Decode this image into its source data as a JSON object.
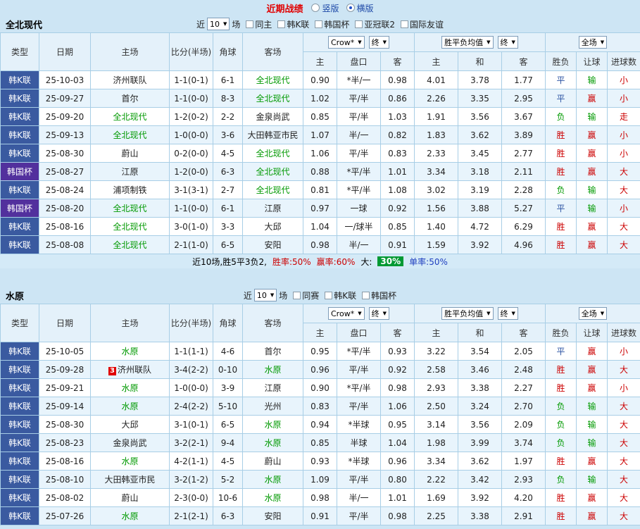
{
  "colors": {
    "accent_red": "#cc0000",
    "lose_green": "#009900",
    "draw_blue": "#2a52a2",
    "focus_team_green": "#009900",
    "league_type_bg": "#3a5aa0",
    "cup_type_bg": "#52309d",
    "highlight_green_bg": "#009933",
    "page_bg": "#cde5f4"
  },
  "top_bar": {
    "title": "近期战绩",
    "radios": [
      {
        "label": "竖版",
        "selected": false
      },
      {
        "label": "横版",
        "selected": true
      }
    ]
  },
  "table_header": {
    "static_cols": [
      "类型",
      "日期",
      "主场",
      "比分(半场)",
      "角球",
      "客场"
    ],
    "odds_group": {
      "dropdowns": [
        "Crow*",
        "终"
      ],
      "cols": [
        "主",
        "盘口",
        "客"
      ]
    },
    "avg_group": {
      "dropdowns": [
        "胜平负均值",
        "终"
      ],
      "cols": [
        "主",
        "和",
        "客"
      ]
    },
    "result_group": {
      "dropdowns": [
        "全场"
      ],
      "cols": [
        "胜负",
        "让球",
        "进球数"
      ]
    }
  },
  "sections": [
    {
      "id": "jeonbuk",
      "team": "全北现代",
      "filter": {
        "near_label": "近",
        "count": "10",
        "games_label": "场",
        "checkboxes": [
          {
            "label": "同主",
            "checked": false
          },
          {
            "label": "韩K联",
            "checked": false
          },
          {
            "label": "韩国杯",
            "checked": false
          },
          {
            "label": "亚冠联2",
            "checked": false
          },
          {
            "label": "国际友谊",
            "checked": false
          }
        ]
      },
      "rows": [
        {
          "type": "韩K联",
          "type_kind": "league",
          "date": "25-10-03",
          "home": {
            "name": "济州联队",
            "focus": false
          },
          "score": "1-1(0-1)",
          "corners": "6-1",
          "away": {
            "name": "全北现代",
            "focus": true
          },
          "odds": [
            "0.90",
            "*半/一",
            "0.98"
          ],
          "avg": [
            "4.01",
            "3.78",
            "1.77"
          ],
          "results": [
            {
              "text": "平",
              "color": "blue"
            },
            {
              "text": "输",
              "color": "green"
            },
            {
              "text": "小",
              "color": "red"
            }
          ]
        },
        {
          "type": "韩K联",
          "type_kind": "league",
          "date": "25-09-27",
          "home": {
            "name": "首尔",
            "focus": false
          },
          "score": "1-1(0-0)",
          "corners": "8-3",
          "away": {
            "name": "全北现代",
            "focus": true
          },
          "odds": [
            "1.02",
            "平/半",
            "0.86"
          ],
          "avg": [
            "2.26",
            "3.35",
            "2.95"
          ],
          "results": [
            {
              "text": "平",
              "color": "blue"
            },
            {
              "text": "赢",
              "color": "red"
            },
            {
              "text": "小",
              "color": "red"
            }
          ]
        },
        {
          "type": "韩K联",
          "type_kind": "league",
          "date": "25-09-20",
          "home": {
            "name": "全北现代",
            "focus": true
          },
          "score": "1-2(0-2)",
          "corners": "2-2",
          "away": {
            "name": "金泉尚武",
            "focus": false
          },
          "odds": [
            "0.85",
            "平/半",
            "1.03"
          ],
          "avg": [
            "1.91",
            "3.56",
            "3.67"
          ],
          "results": [
            {
              "text": "负",
              "color": "green"
            },
            {
              "text": "输",
              "color": "green"
            },
            {
              "text": "走",
              "color": "red"
            }
          ]
        },
        {
          "type": "韩K联",
          "type_kind": "league",
          "date": "25-09-13",
          "home": {
            "name": "全北现代",
            "focus": true
          },
          "score": "1-0(0-0)",
          "corners": "3-6",
          "away": {
            "name": "大田韩亚市民",
            "focus": false
          },
          "odds": [
            "1.07",
            "半/一",
            "0.82"
          ],
          "avg": [
            "1.83",
            "3.62",
            "3.89"
          ],
          "results": [
            {
              "text": "胜",
              "color": "red"
            },
            {
              "text": "赢",
              "color": "red"
            },
            {
              "text": "小",
              "color": "red"
            }
          ]
        },
        {
          "type": "韩K联",
          "type_kind": "league",
          "date": "25-08-30",
          "home": {
            "name": "蔚山",
            "focus": false
          },
          "score": "0-2(0-0)",
          "corners": "4-5",
          "away": {
            "name": "全北现代",
            "focus": true
          },
          "odds": [
            "1.06",
            "平/半",
            "0.83"
          ],
          "avg": [
            "2.33",
            "3.45",
            "2.77"
          ],
          "results": [
            {
              "text": "胜",
              "color": "red"
            },
            {
              "text": "赢",
              "color": "red"
            },
            {
              "text": "小",
              "color": "red"
            }
          ]
        },
        {
          "type": "韩国杯",
          "type_kind": "cup",
          "date": "25-08-27",
          "home": {
            "name": "江原",
            "focus": false
          },
          "score": "1-2(0-0)",
          "corners": "6-3",
          "away": {
            "name": "全北现代",
            "focus": true
          },
          "odds": [
            "0.88",
            "*平/半",
            "1.01"
          ],
          "avg": [
            "3.34",
            "3.18",
            "2.11"
          ],
          "results": [
            {
              "text": "胜",
              "color": "red"
            },
            {
              "text": "赢",
              "color": "red"
            },
            {
              "text": "大",
              "color": "red"
            }
          ]
        },
        {
          "type": "韩K联",
          "type_kind": "league",
          "date": "25-08-24",
          "home": {
            "name": "浦项制铁",
            "focus": false
          },
          "score": "3-1(3-1)",
          "corners": "2-7",
          "away": {
            "name": "全北现代",
            "focus": true
          },
          "odds": [
            "0.81",
            "*平/半",
            "1.08"
          ],
          "avg": [
            "3.02",
            "3.19",
            "2.28"
          ],
          "results": [
            {
              "text": "负",
              "color": "green"
            },
            {
              "text": "输",
              "color": "green"
            },
            {
              "text": "大",
              "color": "red"
            }
          ]
        },
        {
          "type": "韩国杯",
          "type_kind": "cup",
          "date": "25-08-20",
          "home": {
            "name": "全北现代",
            "focus": true
          },
          "score": "1-1(0-0)",
          "corners": "6-1",
          "away": {
            "name": "江原",
            "focus": false
          },
          "odds": [
            "0.97",
            "一球",
            "0.92"
          ],
          "avg": [
            "1.56",
            "3.88",
            "5.27"
          ],
          "results": [
            {
              "text": "平",
              "color": "blue"
            },
            {
              "text": "输",
              "color": "green"
            },
            {
              "text": "小",
              "color": "red"
            }
          ]
        },
        {
          "type": "韩K联",
          "type_kind": "league",
          "date": "25-08-16",
          "home": {
            "name": "全北现代",
            "focus": true
          },
          "score": "3-0(1-0)",
          "corners": "3-3",
          "away": {
            "name": "大邱",
            "focus": false
          },
          "odds": [
            "1.04",
            "一/球半",
            "0.85"
          ],
          "avg": [
            "1.40",
            "4.72",
            "6.29"
          ],
          "results": [
            {
              "text": "胜",
              "color": "red"
            },
            {
              "text": "赢",
              "color": "red"
            },
            {
              "text": "大",
              "color": "red"
            }
          ]
        },
        {
          "type": "韩K联",
          "type_kind": "league",
          "date": "25-08-08",
          "home": {
            "name": "全北现代",
            "focus": true
          },
          "score": "2-1(1-0)",
          "corners": "6-5",
          "away": {
            "name": "安阳",
            "focus": false
          },
          "odds": [
            "0.98",
            "半/一",
            "0.91"
          ],
          "avg": [
            "1.59",
            "3.92",
            "4.96"
          ],
          "results": [
            {
              "text": "胜",
              "color": "red"
            },
            {
              "text": "赢",
              "color": "red"
            },
            {
              "text": "大",
              "color": "red"
            }
          ]
        }
      ],
      "summary": [
        {
          "text": "近10场,胜5平3负2,",
          "style": "plain"
        },
        {
          "text": "胜率:50%",
          "style": "red"
        },
        {
          "text": "赢率:60%",
          "style": "red"
        },
        {
          "text": "大:",
          "style": "plain"
        },
        {
          "text": "30%",
          "style": "highlight"
        },
        {
          "text": "单率:50%",
          "style": "blue"
        }
      ]
    },
    {
      "id": "suwon",
      "team": "水原",
      "filter": {
        "near_label": "近",
        "count": "10",
        "games_label": "场",
        "checkboxes": [
          {
            "label": "同赛",
            "checked": false
          },
          {
            "label": "韩K联",
            "checked": false
          },
          {
            "label": "韩国杯",
            "checked": false
          }
        ]
      },
      "rows": [
        {
          "type": "韩K联",
          "type_kind": "league",
          "date": "25-10-05",
          "home": {
            "name": "水原",
            "focus": true
          },
          "score": "1-1(1-1)",
          "corners": "4-6",
          "away": {
            "name": "首尔",
            "focus": false
          },
          "odds": [
            "0.95",
            "*平/半",
            "0.93"
          ],
          "avg": [
            "3.22",
            "3.54",
            "2.05"
          ],
          "results": [
            {
              "text": "平",
              "color": "blue"
            },
            {
              "text": "赢",
              "color": "red"
            },
            {
              "text": "小",
              "color": "red"
            }
          ]
        },
        {
          "type": "韩K联",
          "type_kind": "league",
          "date": "25-09-28",
          "home": {
            "name": "济州联队",
            "focus": false,
            "badge": "3"
          },
          "score": "3-4(2-2)",
          "corners": "0-10",
          "away": {
            "name": "水原",
            "focus": true
          },
          "odds": [
            "0.96",
            "平/半",
            "0.92"
          ],
          "avg": [
            "2.58",
            "3.46",
            "2.48"
          ],
          "results": [
            {
              "text": "胜",
              "color": "red"
            },
            {
              "text": "赢",
              "color": "red"
            },
            {
              "text": "大",
              "color": "red"
            }
          ]
        },
        {
          "type": "韩K联",
          "type_kind": "league",
          "date": "25-09-21",
          "home": {
            "name": "水原",
            "focus": true
          },
          "score": "1-0(0-0)",
          "corners": "3-9",
          "away": {
            "name": "江原",
            "focus": false
          },
          "odds": [
            "0.90",
            "*平/半",
            "0.98"
          ],
          "avg": [
            "2.93",
            "3.38",
            "2.27"
          ],
          "results": [
            {
              "text": "胜",
              "color": "red"
            },
            {
              "text": "赢",
              "color": "red"
            },
            {
              "text": "小",
              "color": "red"
            }
          ]
        },
        {
          "type": "韩K联",
          "type_kind": "league",
          "date": "25-09-14",
          "home": {
            "name": "水原",
            "focus": true
          },
          "score": "2-4(2-2)",
          "corners": "5-10",
          "away": {
            "name": "光州",
            "focus": false
          },
          "odds": [
            "0.83",
            "平/半",
            "1.06"
          ],
          "avg": [
            "2.50",
            "3.24",
            "2.70"
          ],
          "results": [
            {
              "text": "负",
              "color": "green"
            },
            {
              "text": "输",
              "color": "green"
            },
            {
              "text": "大",
              "color": "red"
            }
          ]
        },
        {
          "type": "韩K联",
          "type_kind": "league",
          "date": "25-08-30",
          "home": {
            "name": "大邱",
            "focus": false
          },
          "score": "3-1(0-1)",
          "corners": "6-5",
          "away": {
            "name": "水原",
            "focus": true
          },
          "odds": [
            "0.94",
            "*半球",
            "0.95"
          ],
          "avg": [
            "3.14",
            "3.56",
            "2.09"
          ],
          "results": [
            {
              "text": "负",
              "color": "green"
            },
            {
              "text": "输",
              "color": "green"
            },
            {
              "text": "大",
              "color": "red"
            }
          ]
        },
        {
          "type": "韩K联",
          "type_kind": "league",
          "date": "25-08-23",
          "home": {
            "name": "金泉尚武",
            "focus": false
          },
          "score": "3-2(2-1)",
          "corners": "9-4",
          "away": {
            "name": "水原",
            "focus": true
          },
          "odds": [
            "0.85",
            "半球",
            "1.04"
          ],
          "avg": [
            "1.98",
            "3.99",
            "3.74"
          ],
          "results": [
            {
              "text": "负",
              "color": "green"
            },
            {
              "text": "输",
              "color": "green"
            },
            {
              "text": "大",
              "color": "red"
            }
          ]
        },
        {
          "type": "韩K联",
          "type_kind": "league",
          "date": "25-08-16",
          "home": {
            "name": "水原",
            "focus": true
          },
          "score": "4-2(1-1)",
          "corners": "4-5",
          "away": {
            "name": "蔚山",
            "focus": false
          },
          "odds": [
            "0.93",
            "*半球",
            "0.96"
          ],
          "avg": [
            "3.34",
            "3.62",
            "1.97"
          ],
          "results": [
            {
              "text": "胜",
              "color": "red"
            },
            {
              "text": "赢",
              "color": "red"
            },
            {
              "text": "大",
              "color": "red"
            }
          ]
        },
        {
          "type": "韩K联",
          "type_kind": "league",
          "date": "25-08-10",
          "home": {
            "name": "大田韩亚市民",
            "focus": false
          },
          "score": "3-2(1-2)",
          "corners": "5-2",
          "away": {
            "name": "水原",
            "focus": true
          },
          "odds": [
            "1.09",
            "平/半",
            "0.80"
          ],
          "avg": [
            "2.22",
            "3.42",
            "2.93"
          ],
          "results": [
            {
              "text": "负",
              "color": "green"
            },
            {
              "text": "输",
              "color": "green"
            },
            {
              "text": "大",
              "color": "red"
            }
          ]
        },
        {
          "type": "韩K联",
          "type_kind": "league",
          "date": "25-08-02",
          "home": {
            "name": "蔚山",
            "focus": false
          },
          "score": "2-3(0-0)",
          "corners": "10-6",
          "away": {
            "name": "水原",
            "focus": true
          },
          "odds": [
            "0.98",
            "半/一",
            "1.01"
          ],
          "avg": [
            "1.69",
            "3.92",
            "4.20"
          ],
          "results": [
            {
              "text": "胜",
              "color": "red"
            },
            {
              "text": "赢",
              "color": "red"
            },
            {
              "text": "大",
              "color": "red"
            }
          ]
        },
        {
          "type": "韩K联",
          "type_kind": "league",
          "date": "25-07-26",
          "home": {
            "name": "水原",
            "focus": true
          },
          "score": "2-1(2-1)",
          "corners": "6-3",
          "away": {
            "name": "安阳",
            "focus": false
          },
          "odds": [
            "0.91",
            "平/半",
            "0.98"
          ],
          "avg": [
            "2.25",
            "3.38",
            "2.91"
          ],
          "results": [
            {
              "text": "胜",
              "color": "red"
            },
            {
              "text": "赢",
              "color": "red"
            },
            {
              "text": "大",
              "color": "red"
            }
          ]
        }
      ]
    }
  ]
}
